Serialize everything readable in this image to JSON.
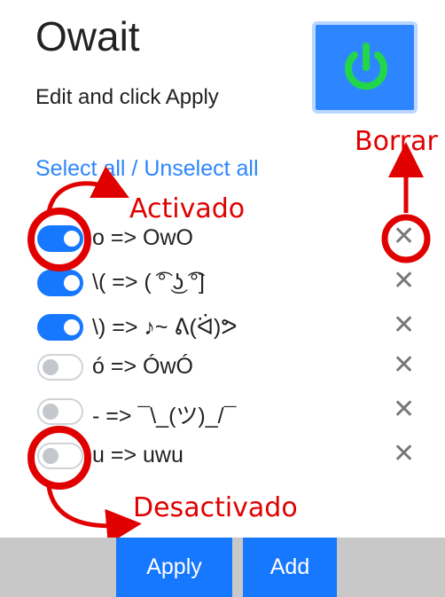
{
  "app": {
    "title": "Owait",
    "subtitle": "Edit and click Apply"
  },
  "power_button": {
    "icon": "power-icon",
    "state": "on"
  },
  "selection": {
    "select_all": "Select all",
    "separator": "/",
    "unselect_all": "Unselect all"
  },
  "rules": [
    {
      "enabled": true,
      "text": "o => OwO"
    },
    {
      "enabled": true,
      "text": "\\( => ( ͡° ͜ʖ ͡°]"
    },
    {
      "enabled": true,
      "text": "\\) => ♪~ ᕕ(ᐛ)ᕗ"
    },
    {
      "enabled": false,
      "text": "ó => ÓwÓ"
    },
    {
      "enabled": false,
      "text": "- => ¯\\_(ツ)_/¯"
    },
    {
      "enabled": false,
      "text": "u => uwu"
    }
  ],
  "delete_label": "✕",
  "annotations": {
    "activado": "Activado",
    "desactivado": "Desactivado",
    "borrar": "Borrar",
    "color": "#e00000"
  },
  "footer": {
    "apply": "Apply",
    "add": "Add"
  },
  "colors": {
    "accent": "#1677ff",
    "power_glyph": "#22d64a",
    "footer_bg": "#c8c8c8"
  }
}
